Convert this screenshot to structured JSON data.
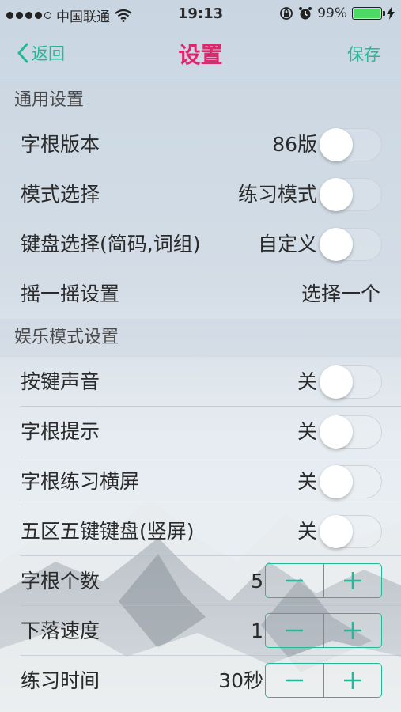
{
  "status_bar": {
    "carrier": "中国联通",
    "time": "19:13",
    "battery_percent": "99%",
    "battery_level": 0.99,
    "icons": [
      "signal-dots-icon",
      "wifi-icon",
      "rotation-lock-icon",
      "alarm-icon",
      "battery-icon",
      "charging-bolt-icon"
    ]
  },
  "nav": {
    "back_label": "返回",
    "title": "设置",
    "save_label": "保存"
  },
  "colors": {
    "accent": "#25b898",
    "title": "#e0276e"
  },
  "sections": [
    {
      "header": "通用设置",
      "rows": [
        {
          "label": "字根版本",
          "value": "86版",
          "control": "toggle"
        },
        {
          "label": "模式选择",
          "value": "练习模式",
          "control": "toggle"
        },
        {
          "label": "键盘选择(简码,词组)",
          "value": "自定义",
          "control": "toggle"
        },
        {
          "label": "摇一摇设置",
          "value": "选择一个",
          "control": "none"
        }
      ]
    },
    {
      "header": "娱乐模式设置",
      "rows": [
        {
          "label": "按键声音",
          "value": "关",
          "control": "toggle"
        },
        {
          "label": "字根提示",
          "value": "关",
          "control": "toggle"
        },
        {
          "label": "字根练习横屏",
          "value": "关",
          "control": "toggle"
        },
        {
          "label": "五区五键键盘(竖屏)",
          "value": "关",
          "control": "toggle"
        },
        {
          "label": "字根个数",
          "value": "5",
          "control": "stepper"
        },
        {
          "label": "下落速度",
          "value": "1",
          "control": "stepper"
        },
        {
          "label": "练习时间",
          "value": "30秒",
          "control": "stepper"
        }
      ]
    }
  ]
}
